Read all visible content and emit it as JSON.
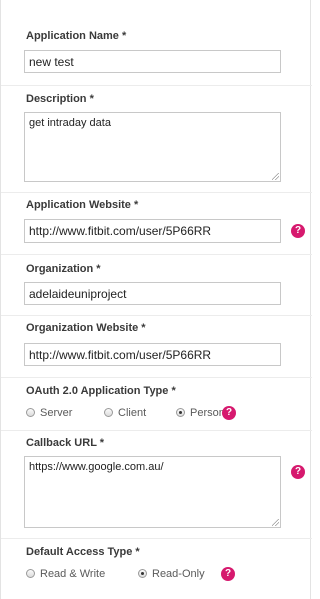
{
  "fields": {
    "app_name": {
      "label": "Application Name *",
      "value": "new test"
    },
    "description": {
      "label": "Description *",
      "value": "get intraday data"
    },
    "app_website": {
      "label": "Application Website *",
      "value": "http://www.fitbit.com/user/5P66RR"
    },
    "organization": {
      "label": "Organization *",
      "value": "adelaideuniproject"
    },
    "org_website": {
      "label": "Organization Website *",
      "value": "http://www.fitbit.com/user/5P66RR"
    },
    "oauth_type": {
      "label": "OAuth 2.0 Application Type *",
      "options": [
        "Server",
        "Client",
        "Personal"
      ],
      "selected": "Personal"
    },
    "callback_url": {
      "label": "Callback URL *",
      "value": "https://www.google.com.au/"
    },
    "access_type": {
      "label": "Default Access Type *",
      "options": [
        "Read & Write",
        "Read-Only"
      ],
      "selected": "Read-Only"
    }
  },
  "help_glyph": "?",
  "icons": [
    "help-icon"
  ],
  "colors": {
    "help_badge": "#d6196e",
    "label_text": "#3a3a3a",
    "input_border": "#c8c8c8"
  }
}
